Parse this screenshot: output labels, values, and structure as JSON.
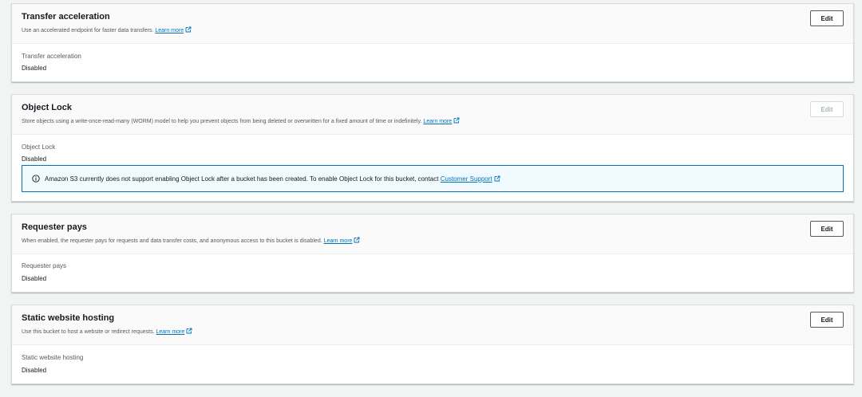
{
  "panels": [
    {
      "title": "Transfer acceleration",
      "description": "Use an accelerated endpoint for faster data transfers.",
      "learn_more": "Learn more",
      "edit_label": "Edit",
      "edit_disabled": false,
      "field_label": "Transfer acceleration",
      "field_value": "Disabled"
    },
    {
      "title": "Object Lock",
      "description": "Store objects using a write-once-read-many (WORM) model to help you prevent objects from being deleted or overwritten for a fixed amount of time or indefinitely.",
      "learn_more": "Learn more",
      "edit_label": "Edit",
      "edit_disabled": true,
      "field_label": "Object Lock",
      "field_value": "Disabled",
      "alert": {
        "text": "Amazon S3 currently does not support enabling Object Lock after a bucket has been created. To enable Object Lock for this bucket, contact",
        "link": "Customer Support"
      }
    },
    {
      "title": "Requester pays",
      "description": "When enabled, the requester pays for requests and data transfer costs, and anonymous access to this bucket is disabled.",
      "learn_more": "Learn more",
      "edit_label": "Edit",
      "edit_disabled": false,
      "field_label": "Requester pays",
      "field_value": "Disabled"
    },
    {
      "title": "Static website hosting",
      "description": "Use this bucket to host a website or redirect requests.",
      "learn_more": "Learn more",
      "edit_label": "Edit",
      "edit_disabled": false,
      "field_label": "Static website hosting",
      "field_value": "Disabled"
    }
  ],
  "colors": {
    "link": "#0073bb",
    "alert_border": "#0073bb",
    "alert_background": "#f1faff",
    "disabled_text": "#aab7b8"
  },
  "icons": {
    "external_link": "external-link-icon",
    "info": "info-icon"
  }
}
